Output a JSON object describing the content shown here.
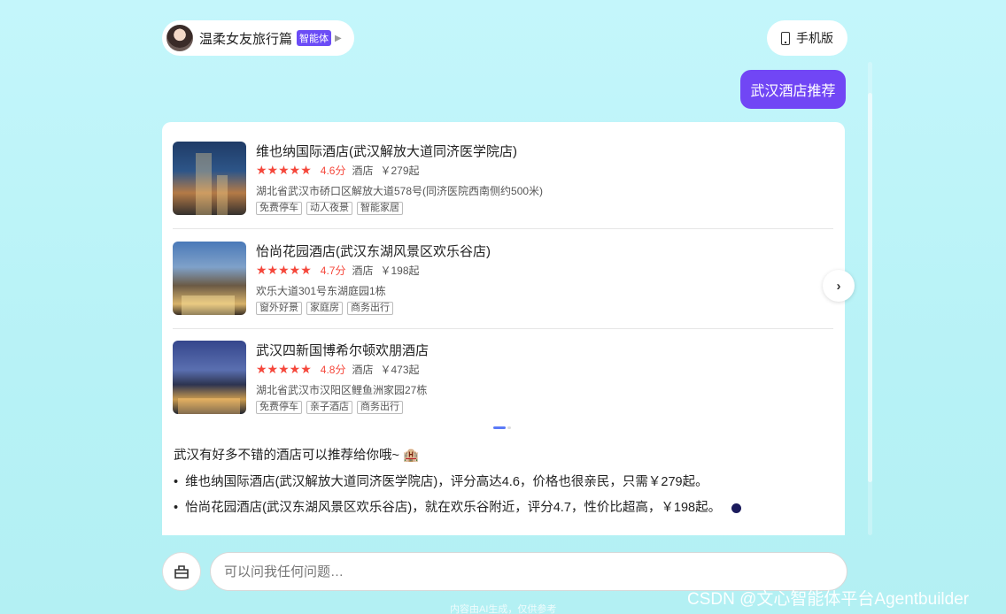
{
  "header": {
    "agent_name": "温柔女友旅行篇",
    "agent_badge": "智能体",
    "mobile_label": "手机版"
  },
  "user_message": "武汉酒店推荐",
  "hotels": [
    {
      "name": "维也纳国际酒店(武汉解放大道同济医学院店)",
      "stars": "★★★★★",
      "score": "4.6分",
      "type": "酒店",
      "price": "￥279起",
      "address": "湖北省武汉市硚口区解放大道578号(同济医院西南侧约500米)",
      "tags": [
        "免费停车",
        "动人夜景",
        "智能家居"
      ]
    },
    {
      "name": "怡尚花园酒店(武汉东湖风景区欢乐谷店)",
      "stars": "★★★★★",
      "score": "4.7分",
      "type": "酒店",
      "price": "￥198起",
      "address": "欢乐大道301号东湖庭园1栋",
      "tags": [
        "窗外好景",
        "家庭房",
        "商务出行"
      ]
    },
    {
      "name": "武汉四新国博希尔顿欢朋酒店",
      "stars": "★★★★★",
      "score": "4.8分",
      "type": "酒店",
      "price": "￥473起",
      "address": "湖北省武汉市汉阳区鲤鱼洲家园27栋",
      "tags": [
        "免费停车",
        "亲子酒店",
        "商务出行"
      ]
    }
  ],
  "summary": {
    "intro": "武汉有好多不错的酒店可以推荐给你哦~ 🏨",
    "bullets": [
      "维也纳国际酒店(武汉解放大道同济医学院店)，评分高达4.6，价格也很亲民，只需￥279起。",
      "怡尚花园酒店(武汉东湖风景区欢乐谷店)，就在欢乐谷附近，评分4.7，性价比超高，￥198起。"
    ]
  },
  "input": {
    "placeholder": "可以问我任何问题…"
  },
  "footer_note": "内容由AI生成，仅供参考",
  "watermark": "CSDN @文心智能体平台Agentbuilder",
  "colors": {
    "accent": "#7146f5",
    "star": "#f5473b",
    "background": "#c4f6fb"
  }
}
